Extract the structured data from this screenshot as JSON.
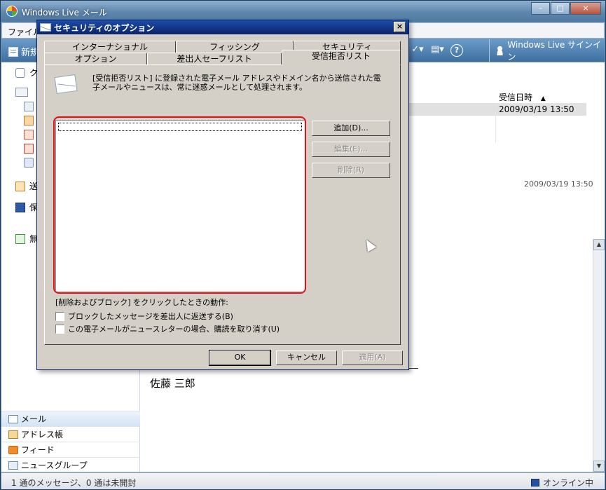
{
  "main": {
    "title": "Windows Live メール",
    "menu_file": "ファイル(",
    "new_label": "新規",
    "signin": "Windows Live サインイン",
    "help": "?",
    "folders": {
      "quick": "ク",
      "sent": "送",
      "saved": "保",
      "unread": "無"
    },
    "list": {
      "column_date": "受信日時",
      "sort_indicator": "▲",
      "row_date": "2009/03/19 13:50"
    },
    "preview": {
      "date": "2009/03/19 13:50",
      "sender": "佐藤 三郎"
    },
    "nav": [
      "メール",
      "アドレス帳",
      "フィード",
      "ニュースグループ"
    ],
    "status": {
      "messages": "1 通のメッセージ、0 通は未開封",
      "online": "オンライン中"
    }
  },
  "dialog": {
    "title": "セキュリティのオプション",
    "close": "×",
    "tabs_back": [
      "インターナショナル",
      "フィッシング",
      "セキュリティ"
    ],
    "tabs_front": [
      "オプション",
      "差出人セーフリスト",
      "受信拒否リスト"
    ],
    "description": "[受信拒否リスト] に登録された電子メール アドレスやドメイン名から送信された電子メールやニュースは、常に迷惑メールとして処理されます。",
    "buttons": {
      "add": "追加(D)...",
      "edit": "編集(E)...",
      "delete": "削除(R)"
    },
    "action_label": "[削除およびブロック] をクリックしたときの動作:",
    "checkboxes": [
      "ブロックしたメッセージを差出人に返送する(B)",
      "この電子メールがニュースレターの場合、購読を取り消す(U)"
    ],
    "footer": {
      "ok": "OK",
      "cancel": "キャンセル",
      "apply": "適用(A)"
    }
  }
}
